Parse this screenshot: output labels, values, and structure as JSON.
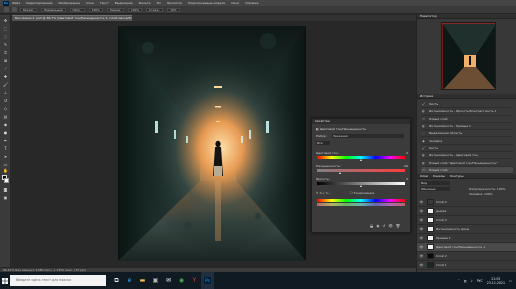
{
  "menu": {
    "items": [
      "Файл",
      "Редактирование",
      "Изображение",
      "Слои",
      "Текст",
      "Выделение",
      "Фильтр",
      "3D",
      "Просмотр",
      "Подключаемые модули",
      "Окно",
      "Справка"
    ]
  },
  "options": {
    "fields": [
      "Режим:",
      "Нормальный",
      "Непр.:",
      "100%",
      "Нажим:",
      "100%",
      "Сглаж.:",
      "10%"
    ]
  },
  "document": {
    "tab_title": "Без имени-1 .psd @ 66,7% (Цветовой тон/Насыщенность 1, Слой-маска/8)"
  },
  "status": {
    "text": "66,67%   Без имени-1 1080 пикс. x 1350 пикс. (72 ppi)"
  },
  "navigator": {
    "title": "Навигатор"
  },
  "history": {
    "title": "История",
    "items": [
      "Кисть",
      "Интенсивность - Яркость/Контрастность 1",
      "Новый слой",
      "Интенсивность - Кривые 1",
      "Выделенная область",
      "Заливка",
      "Кисть",
      "Интенсивность - Цветовой тон",
      "Новый слой \"Цветовой тон/Насыщенность\"",
      "Новый слой"
    ]
  },
  "properties": {
    "title": "Свойства",
    "layer_name": "Цветовой тон/Насыщенность",
    "preset_label": "Набор:",
    "preset_value": "Заказная",
    "channel_value": "Все",
    "hue_label": "Цветовой тон:",
    "hue_value": "0",
    "saturation_label": "Насыщенность:",
    "saturation_value": "-46",
    "lightness_label": "Яркость:",
    "lightness_value": "0",
    "colorize_label": "Тонирование",
    "hue": 0,
    "saturation": -46,
    "lightness": 0
  },
  "layers": {
    "tabs": [
      "Слои",
      "Каналы",
      "Контуры"
    ],
    "filter": "Вид",
    "blend_mode": "Обычные",
    "opacity_label": "Непрозрачность:",
    "opacity_value": "100%",
    "fill_label": "Заливка:",
    "fill_value": "100%",
    "rows": [
      {
        "name": "Слой 4",
        "thumb": "#3b3b3b"
      },
      {
        "name": "дымка",
        "thumb": "#f2f2f2"
      },
      {
        "name": "Слой 3",
        "thumb": "#f2f2f2"
      },
      {
        "name": "Интенсивность фона",
        "thumb": "#f2f2f2"
      },
      {
        "name": "Кривые 1",
        "thumb": "#f2f2f2"
      },
      {
        "name": "Цветовой тон/Насыщенность 1",
        "thumb": "#f2f2f2"
      },
      {
        "name": "Слой 2",
        "thumb": "#0a0a0a"
      },
      {
        "name": "Слой 1",
        "thumb": "#182624"
      }
    ]
  },
  "taskbar": {
    "search_placeholder": "Введите здесь текст для поиска",
    "icons": [
      "taskview-icon",
      "edge-icon",
      "folder-icon",
      "store-icon",
      "mail-icon",
      "chrome-icon",
      "yandex-icon",
      "photoshop-icon"
    ],
    "time": "21:05",
    "date": "23.11.2021",
    "lang": "РУС"
  },
  "colors": {
    "accent": "#31a8ff",
    "panel_bg": "#383838",
    "taskbar_bg": "#101a22"
  }
}
